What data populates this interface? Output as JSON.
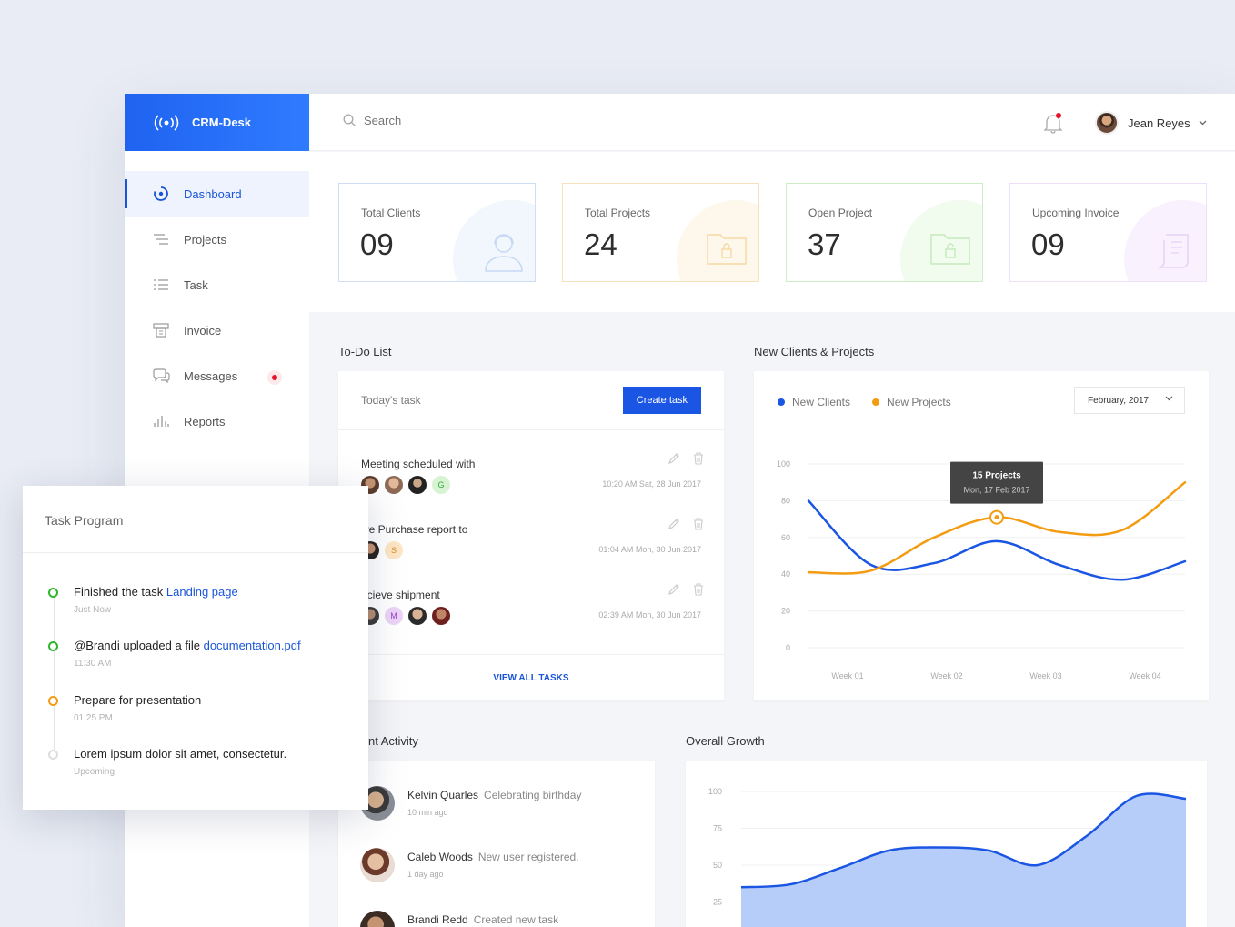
{
  "app": {
    "brand": "CRM-Desk"
  },
  "sidebar": {
    "items": [
      {
        "label": "Dashboard",
        "icon": "dashboard-icon",
        "active": true
      },
      {
        "label": "Projects",
        "icon": "projects-icon"
      },
      {
        "label": "Task",
        "icon": "task-list-icon"
      },
      {
        "label": "Invoice",
        "icon": "invoice-icon"
      },
      {
        "label": "Messages",
        "icon": "messages-icon"
      },
      {
        "label": "Reports",
        "icon": "reports-icon"
      }
    ]
  },
  "topbar": {
    "search_placeholder": "Search",
    "user_name": "Jean Reyes"
  },
  "stats": [
    {
      "label": "Total Clients",
      "value": "09",
      "color": "#a9c6f2"
    },
    {
      "label": "Total Projects",
      "value": "24",
      "color": "#f6d59b"
    },
    {
      "label": "Open Project",
      "value": "37",
      "color": "#b6e3a8"
    },
    {
      "label": "Upcoming Invoice",
      "value": "09",
      "color": "#e4ccf5"
    }
  ],
  "todo": {
    "title": "To-Do List",
    "subtitle": "Today's task",
    "create_label": "Create task",
    "view_all_label": "VIEW ALL TASKS",
    "tasks": [
      {
        "title": "Meeting scheduled with",
        "time": "10:20 AM Sat, 28 Jun 2017",
        "letter": "G"
      },
      {
        "title": "ive Purchase report to",
        "time": "01:04 AM Mon, 30 Jun 2017",
        "letter": "S"
      },
      {
        "title": "ecieve shipment",
        "time": "02:39 AM Mon, 30 Jun 2017",
        "letter": "M"
      }
    ]
  },
  "clients_chart": {
    "title": "New Clients & Projects",
    "legend": [
      "New Clients",
      "New Projects"
    ],
    "month": "February, 2017",
    "tooltip_title": "15 Projects",
    "tooltip_date": "Mon, 17 Feb 2017"
  },
  "chart_data": [
    {
      "type": "line",
      "x": [
        "Week 01",
        "Week 02",
        "Week 03",
        "Week 04"
      ],
      "yticks": [
        0,
        20,
        40,
        60,
        80,
        100
      ],
      "ylim": [
        0,
        100
      ],
      "series": [
        {
          "name": "New Clients",
          "color": "#1a55e3",
          "values": [
            80,
            45,
            46,
            58,
            45,
            37,
            47
          ]
        },
        {
          "name": "New Projects",
          "color": "#f39c12",
          "values": [
            41,
            42,
            60,
            71,
            63,
            64,
            90
          ]
        }
      ],
      "grid": true
    },
    {
      "type": "area",
      "yticks": [
        25,
        50,
        75,
        100
      ],
      "ylim": [
        0,
        100
      ],
      "series": [
        {
          "color": "#1a55e3",
          "values": [
            35,
            37,
            48,
            60,
            62,
            60,
            50,
            70,
            97,
            95
          ]
        }
      ],
      "grid": true
    }
  ],
  "activity": {
    "title": "nt Activity",
    "items": [
      {
        "name": "Kelvin Quarles",
        "action": "Celebrating birthday",
        "time": "10 min ago"
      },
      {
        "name": "Caleb Woods",
        "action": "New user registered.",
        "time": "1 day ago"
      },
      {
        "name": "Brandi Redd",
        "action": "Created new task",
        "time": ""
      }
    ]
  },
  "growth": {
    "title": "Overall Growth"
  },
  "task_program": {
    "title": "Task Program",
    "items": [
      {
        "text": "Finished the task",
        "link": "Landing page",
        "sub": "Just Now",
        "color": "#2db72d"
      },
      {
        "text": "@Brandi uploaded a file",
        "link": "documentation.pdf",
        "sub": "11:30 AM",
        "color": "#2db72d"
      },
      {
        "text": "Prepare for presentation",
        "link": "",
        "sub": "01:25 PM",
        "color": "#f39c12"
      },
      {
        "text": "Lorem ipsum dolor sit amet, consectetur.",
        "link": "",
        "sub": "Upcoming",
        "color": "#dddddd"
      }
    ]
  }
}
